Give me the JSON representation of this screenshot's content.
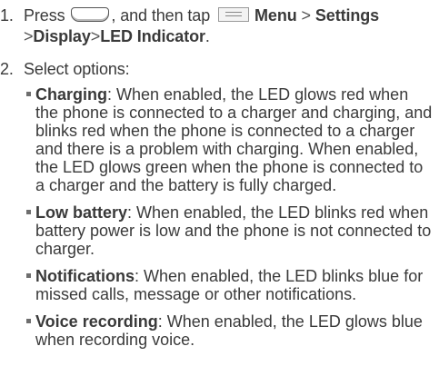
{
  "step1": {
    "number": "1.",
    "text_press": "Press",
    "home_button_icon": "home-button-icon",
    "text_then_tap": ", and then tap",
    "menu_icon": "menu-icon",
    "path": [
      "Menu",
      "Settings",
      "Display",
      "LED Indicator"
    ],
    "separator": ">",
    "end": "."
  },
  "step2": {
    "number": "2.",
    "text": "Select options:"
  },
  "options": [
    {
      "title": "Charging",
      "desc": ": When enabled, the LED glows red when the phone is connected to a charger and charging, and blinks red when the phone is connected to a charger and there is a problem with charging. When enabled, the LED glows green when the phone is connected to a charger and the battery is fully charged."
    },
    {
      "title": "Low battery",
      "desc": ": When enabled, the LED blinks red when battery power is low and the phone is not connected to charger."
    },
    {
      "title": "Notifications",
      "desc": ": When enabled, the LED blinks blue for missed calls, message or other notifications."
    },
    {
      "title": "Voice recording",
      "desc": ": When enabled, the LED glows blue when recording voice."
    }
  ]
}
